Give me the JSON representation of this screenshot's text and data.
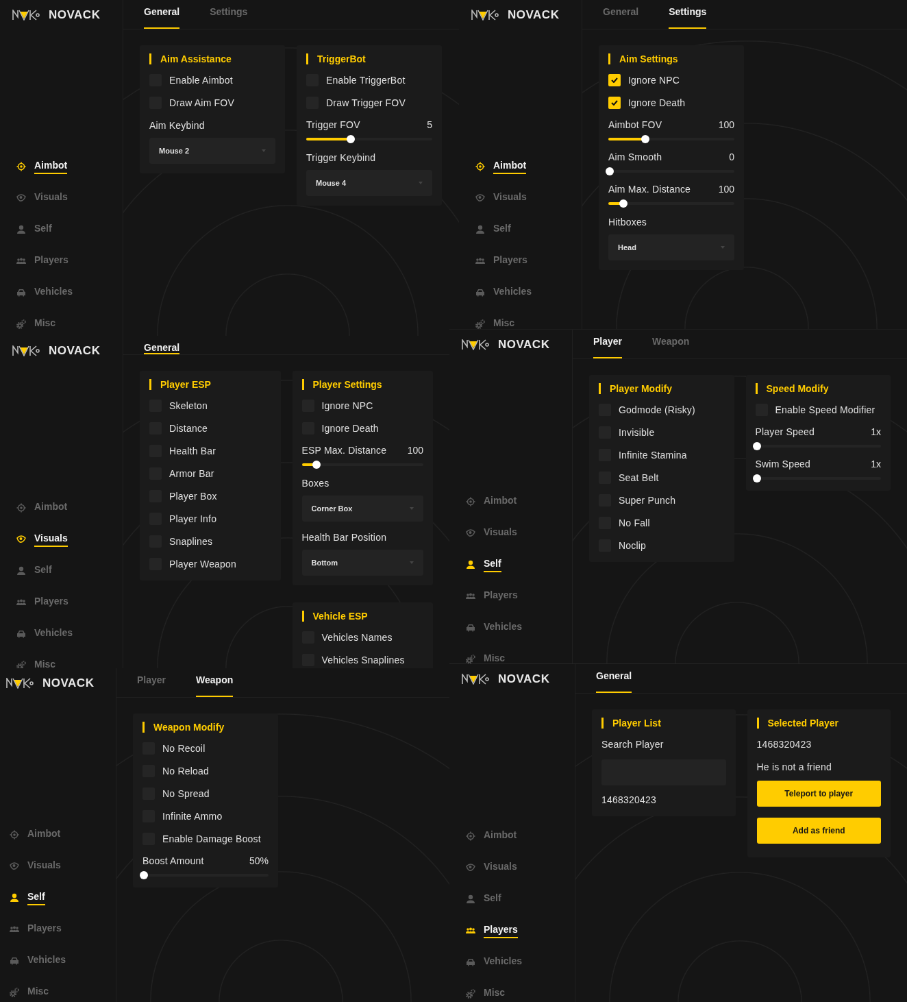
{
  "panels": [
    {
      "brand": "NOVACK",
      "nav": [
        {
          "label": "Aimbot",
          "selected": true
        },
        {
          "label": "Visuals",
          "selected": false
        },
        {
          "label": "Self",
          "selected": false
        },
        {
          "label": "Players",
          "selected": false
        },
        {
          "label": "Vehicles",
          "selected": false
        },
        {
          "label": "Misc",
          "selected": false
        }
      ],
      "tabs": [
        {
          "label": "General",
          "selected": true
        },
        {
          "label": "Settings",
          "selected": false
        }
      ],
      "columns": [
        [
          {
            "title": "Aim Assistance",
            "rows": [
              {
                "kind": "checkbox",
                "label": "Enable Aimbot",
                "checked": false
              },
              {
                "kind": "checkbox",
                "label": "Draw Aim FOV",
                "checked": false
              },
              {
                "kind": "label",
                "label": "Aim Keybind"
              },
              {
                "kind": "dropdown",
                "value": "Mouse 2"
              }
            ]
          }
        ],
        [
          {
            "title": "TriggerBot",
            "rows": [
              {
                "kind": "checkbox",
                "label": "Enable TriggerBot",
                "checked": false
              },
              {
                "kind": "checkbox",
                "label": "Draw Trigger FOV",
                "checked": false
              },
              {
                "kind": "slider",
                "label": "Trigger FOV",
                "value": "5",
                "level": 0.34
              },
              {
                "kind": "label",
                "label": "Trigger Keybind"
              },
              {
                "kind": "dropdown",
                "value": "Mouse 4"
              }
            ]
          }
        ]
      ]
    },
    {
      "brand": "NOVACK",
      "nav": [
        {
          "label": "Aimbot",
          "selected": true
        },
        {
          "label": "Visuals",
          "selected": false
        },
        {
          "label": "Self",
          "selected": false
        },
        {
          "label": "Players",
          "selected": false
        },
        {
          "label": "Vehicles",
          "selected": false
        },
        {
          "label": "Misc",
          "selected": false
        }
      ],
      "tabs": [
        {
          "label": "General",
          "selected": false
        },
        {
          "label": "Settings",
          "selected": true
        }
      ],
      "columns": [
        [
          {
            "title": "Aim Settings",
            "rows": [
              {
                "kind": "checkbox",
                "label": "Ignore NPC",
                "checked": true
              },
              {
                "kind": "checkbox",
                "label": "Ignore Death",
                "checked": true
              },
              {
                "kind": "slider",
                "label": "Aimbot FOV",
                "value": "100",
                "level": 0.28
              },
              {
                "kind": "slider",
                "label": "Aim Smooth",
                "value": "0",
                "level": 0
              },
              {
                "kind": "slider",
                "label": "Aim Max. Distance",
                "value": "100",
                "level": 0.11
              },
              {
                "kind": "label",
                "label": "Hitboxes"
              },
              {
                "kind": "dropdown",
                "value": "Head"
              }
            ]
          }
        ]
      ]
    },
    {
      "brand": "NOVACK",
      "nav": [
        {
          "label": "Aimbot",
          "selected": false
        },
        {
          "label": "Visuals",
          "selected": true
        },
        {
          "label": "Self",
          "selected": false
        },
        {
          "label": "Players",
          "selected": false
        },
        {
          "label": "Vehicles",
          "selected": false
        },
        {
          "label": "Misc",
          "selected": false
        }
      ],
      "tabs": [
        {
          "label": "General",
          "selected": true
        }
      ],
      "columns": [
        [
          {
            "title": "Player ESP",
            "rows": [
              {
                "kind": "checkbox",
                "label": "Skeleton",
                "checked": false
              },
              {
                "kind": "checkbox",
                "label": "Distance",
                "checked": false
              },
              {
                "kind": "checkbox",
                "label": "Health Bar",
                "checked": false
              },
              {
                "kind": "checkbox",
                "label": "Armor Bar",
                "checked": false
              },
              {
                "kind": "checkbox",
                "label": "Player Box",
                "checked": false
              },
              {
                "kind": "checkbox",
                "label": "Player Info",
                "checked": false
              },
              {
                "kind": "checkbox",
                "label": "Snaplines",
                "checked": false
              },
              {
                "kind": "checkbox",
                "label": "Player Weapon",
                "checked": false
              }
            ]
          }
        ],
        [
          {
            "title": "Player Settings",
            "rows": [
              {
                "kind": "checkbox",
                "label": "Ignore NPC",
                "checked": false
              },
              {
                "kind": "checkbox",
                "label": "Ignore Death",
                "checked": false
              },
              {
                "kind": "slider",
                "label": "ESP Max. Distance",
                "value": "100",
                "level": 0.11
              },
              {
                "kind": "label",
                "label": "Boxes"
              },
              {
                "kind": "dropdown",
                "value": "Corner Box"
              },
              {
                "kind": "label",
                "label": "Health Bar Position"
              },
              {
                "kind": "dropdown",
                "value": "Bottom"
              }
            ]
          },
          {
            "title": "Vehicle ESP",
            "rows": [
              {
                "kind": "checkbox",
                "label": "Vehicles Names",
                "checked": false
              },
              {
                "kind": "checkbox",
                "label": "Vehicles Snaplines",
                "checked": false
              }
            ]
          }
        ]
      ]
    },
    {
      "brand": "NOVACK",
      "nav": [
        {
          "label": "Aimbot",
          "selected": false
        },
        {
          "label": "Visuals",
          "selected": false
        },
        {
          "label": "Self",
          "selected": true
        },
        {
          "label": "Players",
          "selected": false
        },
        {
          "label": "Vehicles",
          "selected": false
        },
        {
          "label": "Misc",
          "selected": false
        }
      ],
      "tabs": [
        {
          "label": "Player",
          "selected": true
        },
        {
          "label": "Weapon",
          "selected": false
        }
      ],
      "columns": [
        [
          {
            "title": "Player Modify",
            "rows": [
              {
                "kind": "checkbox",
                "label": "Godmode (Risky)",
                "checked": false
              },
              {
                "kind": "checkbox",
                "label": "Invisible",
                "checked": false
              },
              {
                "kind": "checkbox",
                "label": "Infinite Stamina",
                "checked": false
              },
              {
                "kind": "checkbox",
                "label": "Seat Belt",
                "checked": false
              },
              {
                "kind": "checkbox",
                "label": "Super Punch",
                "checked": false
              },
              {
                "kind": "checkbox",
                "label": "No Fall",
                "checked": false
              },
              {
                "kind": "checkbox",
                "label": "Noclip",
                "checked": false
              }
            ]
          }
        ],
        [
          {
            "title": "Speed Modify",
            "rows": [
              {
                "kind": "checkbox",
                "label": "Enable Speed Modifier",
                "checked": false
              },
              {
                "kind": "slider",
                "label": "Player Speed",
                "value": "1x",
                "level": 0
              },
              {
                "kind": "slider",
                "label": "Swim Speed",
                "value": "1x",
                "level": 0
              }
            ]
          }
        ]
      ]
    },
    {
      "brand": "NOVACK",
      "nav": [
        {
          "label": "Aimbot",
          "selected": false
        },
        {
          "label": "Visuals",
          "selected": false
        },
        {
          "label": "Self",
          "selected": true
        },
        {
          "label": "Players",
          "selected": false
        },
        {
          "label": "Vehicles",
          "selected": false
        },
        {
          "label": "Misc",
          "selected": false
        }
      ],
      "tabs": [
        {
          "label": "Player",
          "selected": false
        },
        {
          "label": "Weapon",
          "selected": true
        }
      ],
      "columns": [
        [
          {
            "title": "Weapon Modify",
            "rows": [
              {
                "kind": "checkbox",
                "label": "No Recoil",
                "checked": false
              },
              {
                "kind": "checkbox",
                "label": "No Reload",
                "checked": false
              },
              {
                "kind": "checkbox",
                "label": "No Spread",
                "checked": false
              },
              {
                "kind": "checkbox",
                "label": "Infinite Ammo",
                "checked": false
              },
              {
                "kind": "checkbox",
                "label": "Enable Damage Boost",
                "checked": false
              },
              {
                "kind": "slider",
                "label": "Boost Amount",
                "value": "50%",
                "level": 0
              }
            ]
          }
        ]
      ]
    },
    {
      "brand": "NOVACK",
      "nav": [
        {
          "label": "Aimbot",
          "selected": false
        },
        {
          "label": "Visuals",
          "selected": false
        },
        {
          "label": "Self",
          "selected": false
        },
        {
          "label": "Players",
          "selected": true
        },
        {
          "label": "Vehicles",
          "selected": false
        },
        {
          "label": "Misc",
          "selected": false
        }
      ],
      "tabs": [
        {
          "label": "General",
          "selected": true
        }
      ],
      "columns": [
        [
          {
            "title": "Player List",
            "rows": [
              {
                "kind": "label",
                "label": "Search Player"
              },
              {
                "kind": "input"
              },
              {
                "kind": "list_item",
                "label": "1468320423"
              }
            ]
          }
        ],
        [
          {
            "title": "Selected Player",
            "rows": [
              {
                "kind": "text",
                "label": "1468320423"
              },
              {
                "kind": "text",
                "label": "He is not a friend"
              },
              {
                "kind": "button",
                "label": "Teleport to player"
              },
              {
                "kind": "button",
                "label": "Add as friend"
              }
            ]
          }
        ]
      ]
    }
  ]
}
